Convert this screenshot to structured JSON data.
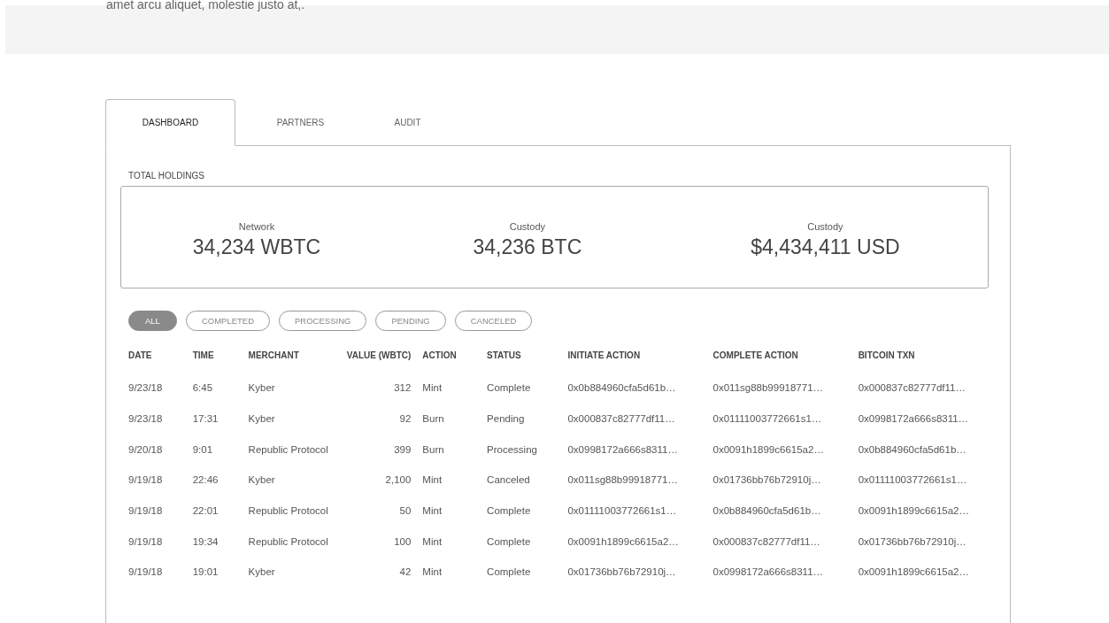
{
  "banner": {
    "text": "amet arcu aliquet, molestie justo at,."
  },
  "tabs": [
    {
      "label": "DASHBOARD",
      "selected": true
    },
    {
      "label": "PARTNERS",
      "selected": false
    },
    {
      "label": "AUDIT",
      "selected": false
    }
  ],
  "holdings": {
    "title": "TOTAL HOLDINGS",
    "items": [
      {
        "label": "Network",
        "value": "34,234 WBTC"
      },
      {
        "label": "Custody",
        "value": "34,236 BTC"
      },
      {
        "label": "Custody",
        "value": "$4,434,411 USD"
      }
    ]
  },
  "filters": [
    {
      "label": "ALL",
      "selected": true
    },
    {
      "label": "COMPLETED",
      "selected": false
    },
    {
      "label": "PROCESSING",
      "selected": false
    },
    {
      "label": "PENDING",
      "selected": false
    },
    {
      "label": "CANCELED",
      "selected": false
    }
  ],
  "table": {
    "columns": [
      "DATE",
      "TIME",
      "MERCHANT",
      "VALUE (WBTC)",
      "ACTION",
      "STATUS",
      "INITIATE ACTION",
      "COMPLETE ACTION",
      "BITCOIN TXN"
    ],
    "rows": [
      [
        "9/23/18",
        "6:45",
        "Kyber",
        "312",
        "Mint",
        "Complete",
        "0x0b884960cfa5d61b…",
        "0x011sg88b99918771…",
        "0x000837c82777df11…"
      ],
      [
        "9/23/18",
        "17:31",
        "Kyber",
        "92",
        "Burn",
        "Pending",
        "0x000837c82777df11…",
        "0x01111003772661s1…",
        "0x0998172a666s8311…"
      ],
      [
        "9/20/18",
        "9:01",
        "Republic Protocol",
        "399",
        "Burn",
        "Processing",
        "0x0998172a666s8311…",
        "0x0091h1899c6615a2…",
        "0x0b884960cfa5d61b…"
      ],
      [
        "9/19/18",
        "22:46",
        "Kyber",
        "2,100",
        "Mint",
        "Canceled",
        "0x011sg88b99918771…",
        "0x01736bb76b72910j…",
        "0x01111003772661s1…"
      ],
      [
        "9/19/18",
        "22:01",
        "Republic Protocol",
        "50",
        "Mint",
        "Complete",
        "0x01111003772661s1…",
        "0x0b884960cfa5d61b…",
        "0x0091h1899c6615a2…"
      ],
      [
        "9/19/18",
        "19:34",
        "Republic Protocol",
        "100",
        "Mint",
        "Complete",
        "0x0091h1899c6615a2…",
        "0x000837c82777df11…",
        "0x01736bb76b72910j…"
      ],
      [
        "9/19/18",
        "19:01",
        "Kyber",
        "42",
        "Mint",
        "Complete",
        "0x01736bb76b72910j…",
        "0x0998172a666s8311…",
        "0x0091h1899c6615a2…"
      ]
    ]
  }
}
